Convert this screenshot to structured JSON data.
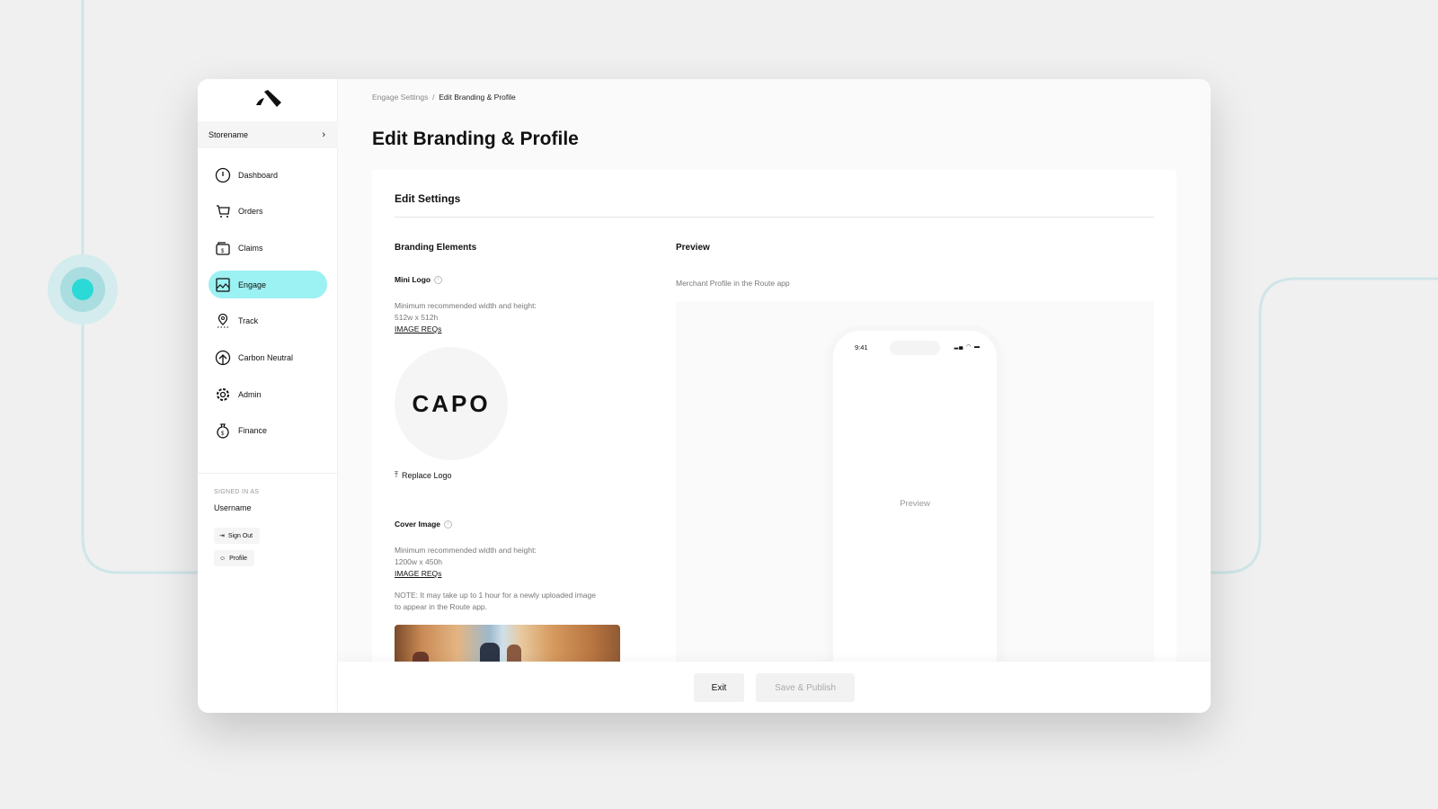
{
  "brand_color": "#9cf1f2",
  "accent_decoration": "#2bd9d6",
  "sidebar": {
    "store": "Storename",
    "items": [
      {
        "label": "Dashboard",
        "icon": "gauge-icon"
      },
      {
        "label": "Orders",
        "icon": "cart-icon"
      },
      {
        "label": "Claims",
        "icon": "folder-dollar-icon"
      },
      {
        "label": "Engage",
        "icon": "image-icon",
        "active": true
      },
      {
        "label": "Track",
        "icon": "location-pin-icon"
      },
      {
        "label": "Carbon Neutral",
        "icon": "tree-circle-icon"
      },
      {
        "label": "Admin",
        "icon": "gear-icon"
      },
      {
        "label": "Finance",
        "icon": "money-bag-icon"
      }
    ],
    "signed_in_as": "SIGNED IN AS",
    "username": "Username",
    "sign_out": "Sign Out",
    "profile": "Profile"
  },
  "breadcrumb": {
    "parent": "Engage Settings",
    "separator": "/",
    "current": "Edit Branding & Profile"
  },
  "page_title": "Edit Branding & Profile",
  "panel": {
    "title": "Edit Settings",
    "branding": {
      "heading": "Branding Elements",
      "mini_logo": {
        "label": "Mini Logo",
        "req": "Minimum recommended width and height:",
        "size": "512w x 512h",
        "link": "IMAGE REQs",
        "logo_text": "CAPO",
        "replace": "Replace Logo"
      },
      "cover": {
        "label": "Cover Image",
        "req": "Minimum recommended width and height:",
        "size": "1200w x 450h",
        "link": "IMAGE REQs",
        "note1": "NOTE: It may take up to 1 hour for a newly uploaded image",
        "note2": "to appear in the Route app."
      }
    },
    "preview": {
      "heading": "Preview",
      "subtitle": "Merchant Profile in the Route app",
      "time": "9:41",
      "placeholder": "Preview"
    }
  },
  "footer": {
    "exit": "Exit",
    "save": "Save & Publish"
  }
}
